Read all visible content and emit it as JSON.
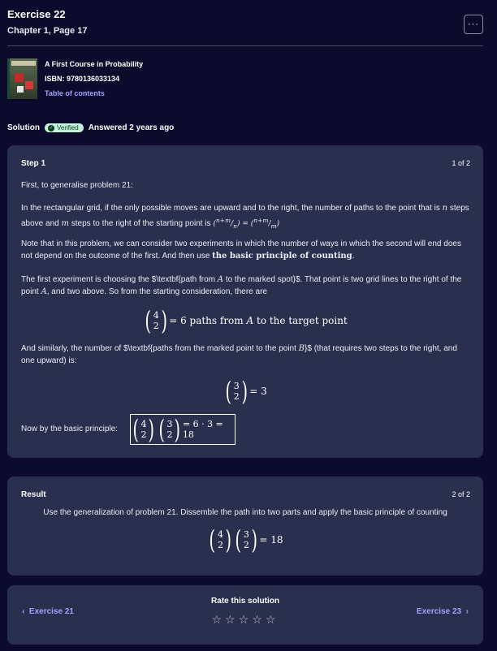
{
  "header": {
    "title": "Exercise 22",
    "subtitle": "Chapter 1, Page 17",
    "menu_label": "···"
  },
  "book": {
    "cover_text": "A First Course in Probability",
    "title": "A First Course in Probability",
    "isbn": "ISBN: 9780136033134",
    "toc": "Table of contents"
  },
  "solution": {
    "label": "Solution",
    "verified": "Verified",
    "answered": "Answered 2 years ago"
  },
  "step1": {
    "title": "Step 1",
    "count": "1 of 2",
    "p1": "First, to generalise problem 21:",
    "p2a": "In the rectangular grid, if the only possible moves are upward and to the right, the number of paths to the point",
    "p2b": "that is",
    "p2c": "steps above and",
    "p2d": "steps to the right of the starting point is",
    "var_n": "n",
    "var_m": "m",
    "binom_top": "n+m",
    "binom_bot_n": "n",
    "binom_bot_m": "m",
    "eq_sign": "=",
    "p3a": "Note that in this problem, we can consider two experiments in which the number of ways in which the second will end does not depend on the outcome of the first. And then use",
    "p3b": "the basic principle of counting",
    "p3c": ".",
    "p4a": "The first experiment is choosing the $\\textbf{path from",
    "var_A": "A",
    "p4b": "to the marked spot}$. That point is two grid lines to the right of the point",
    "p4c": ", and two above. So from the starting consideration, there are",
    "eq1_top": "4",
    "eq1_bot": "2",
    "eq1_rest": "= 6 paths from",
    "eq1_end": "to the target point",
    "p5a": "And similarly, the number of $\\textbf{paths from the marked point to the point",
    "var_B": "B",
    "p5b": "}$ (that requires two steps to the right, and one upward) is:",
    "eq2_top": "3",
    "eq2_bot": "2",
    "eq2_rest": "= 3",
    "p6": "Now by the basic principle:",
    "eq3_rest": "= 6 · 3 = 18"
  },
  "result": {
    "title": "Result",
    "count": "2 of 2",
    "text": "Use the generalization of problem 21. Dissemble the path into two parts and apply the basic principle of counting",
    "eq_rest": "= 18"
  },
  "nav": {
    "prev": "Exercise 21",
    "next": "Exercise 23",
    "rate": "Rate this solution",
    "stars": "☆☆☆☆☆",
    "prev_arrow": "‹",
    "next_arrow": "›"
  }
}
